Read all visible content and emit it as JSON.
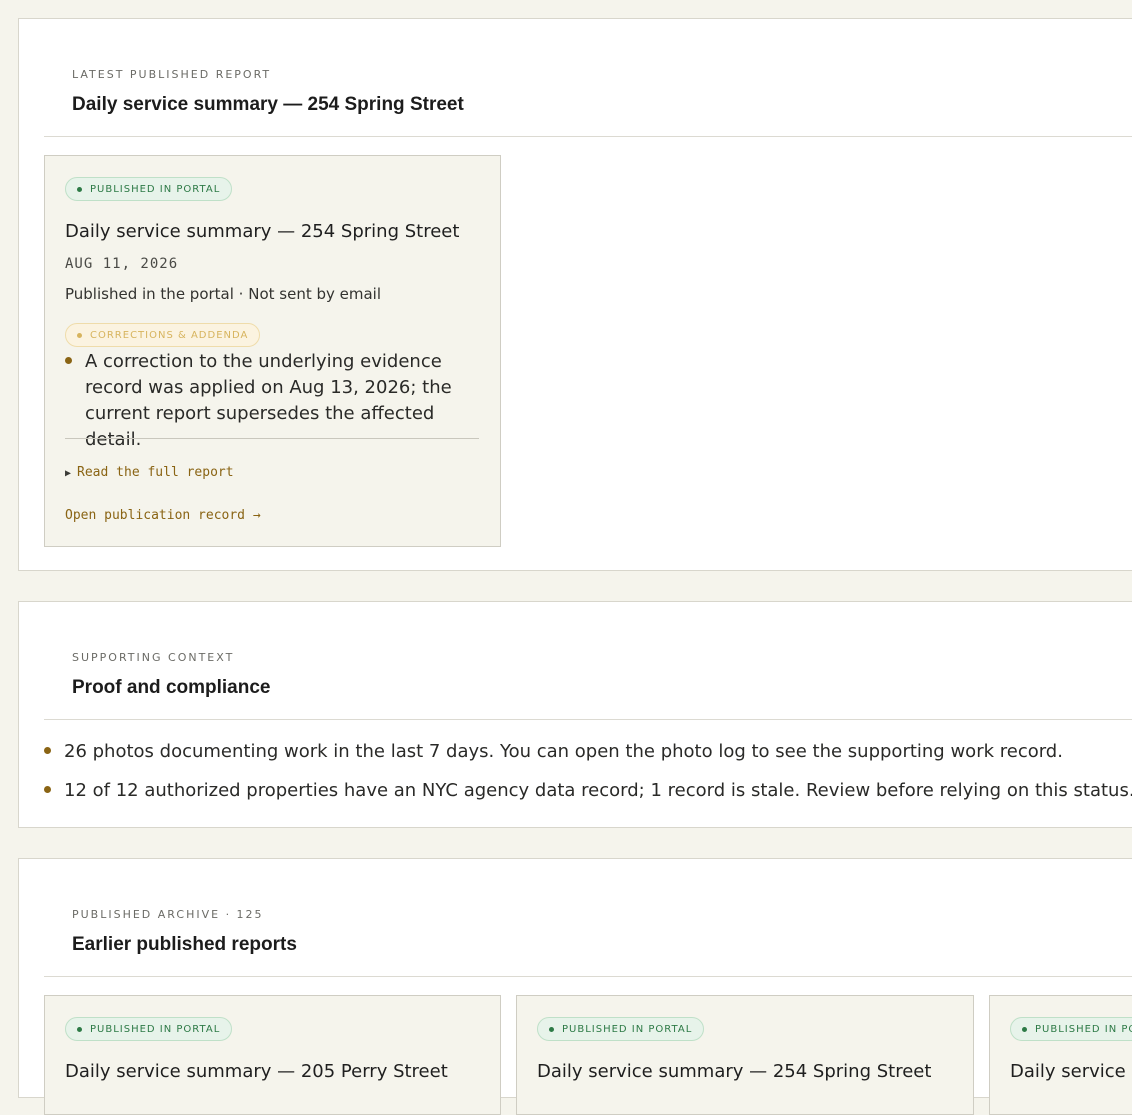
{
  "latest": {
    "eyebrow": "LATEST PUBLISHED REPORT",
    "title": "Daily service summary — 254 Spring Street",
    "card": {
      "status": "PUBLISHED IN PORTAL",
      "title": "Daily service summary — 254 Spring Street",
      "date": "AUG 11, 2026",
      "meta": "Published in the portal · Not sent by email",
      "corrections_label": "CORRECTIONS & ADDENDA",
      "correction_text": "A correction to the underlying evidence record was applied on Aug 13, 2026; the current report supersedes the affected detail.",
      "read_full": "Read the full report",
      "open_record": "Open publication record →"
    }
  },
  "proof": {
    "eyebrow": "SUPPORTING CONTEXT",
    "title": "Proof and compliance",
    "items": [
      "26 photos documenting work in the last 7 days. You can open the photo log to see the supporting work record.",
      "12 of 12 authorized properties have an NYC agency data record; 1 record is stale. Review before relying on this status."
    ]
  },
  "archive": {
    "eyebrow": "PUBLISHED ARCHIVE · 125",
    "title": "Earlier published reports",
    "cards": [
      {
        "status": "PUBLISHED IN PORTAL",
        "title": "Daily service summary — 205 Perry Street"
      },
      {
        "status": "PUBLISHED IN PORTAL",
        "title": "Daily service summary — 254 Spring Street"
      },
      {
        "status": "PUBLISHED IN PORTAL",
        "title": "Daily service summary"
      }
    ]
  },
  "colors": {
    "page_bg": "#f5f4ec",
    "accent": "#8a6414",
    "published_green": "#2d7a46",
    "corrections_amber": "#d7b45e"
  }
}
